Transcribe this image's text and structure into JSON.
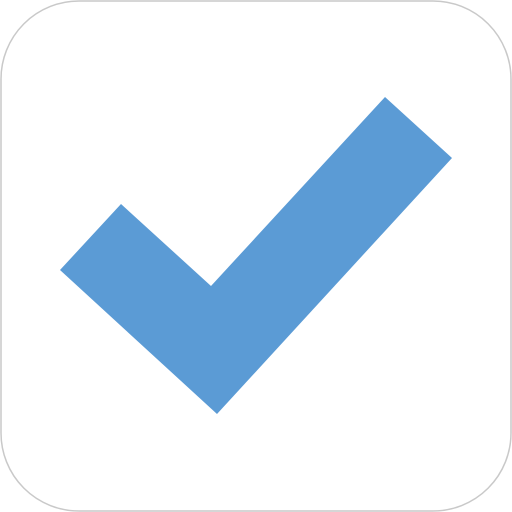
{
  "icon": {
    "name": "checkmark-icon",
    "colors": {
      "tile_fill": "#ffffff",
      "tile_border": "#c9c9c9",
      "check": "#5b9bd5"
    }
  }
}
